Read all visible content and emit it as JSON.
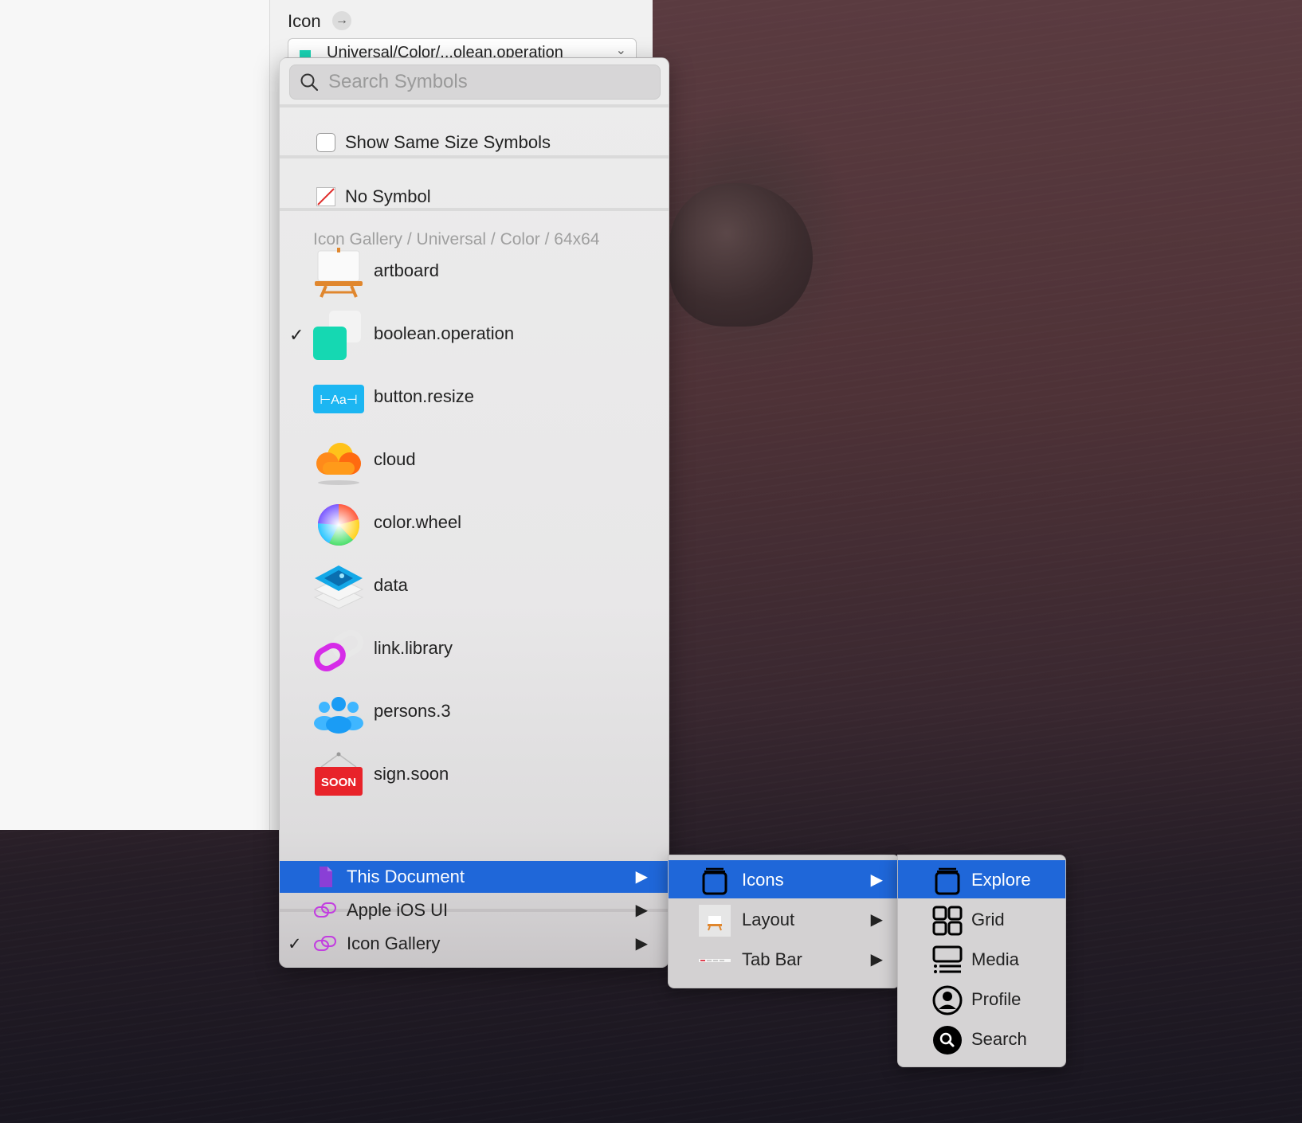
{
  "inspector": {
    "icon_label": "Icon",
    "selected_symbol_text": "Universal/Color/...olean.operation"
  },
  "menu": {
    "search_placeholder": "Search Symbols",
    "show_same_size_label": "Show Same Size Symbols",
    "no_symbol_label": "No Symbol",
    "group_header": "Icon Gallery / Universal / Color / 64x64",
    "symbols": [
      {
        "label": "artboard",
        "icon": "artboard-icon",
        "checked": false
      },
      {
        "label": "boolean.operation",
        "icon": "boolean-operation-icon",
        "checked": true
      },
      {
        "label": "button.resize",
        "icon": "button-resize-icon",
        "checked": false
      },
      {
        "label": "cloud",
        "icon": "cloud-icon",
        "checked": false
      },
      {
        "label": "color.wheel",
        "icon": "color-wheel-icon",
        "checked": false
      },
      {
        "label": "data",
        "icon": "data-icon",
        "checked": false
      },
      {
        "label": "link.library",
        "icon": "link-library-icon",
        "checked": false
      },
      {
        "label": "persons.3",
        "icon": "persons-icon",
        "checked": false
      },
      {
        "label": "sign.soon",
        "icon": "sign-soon-icon",
        "checked": false
      }
    ],
    "button_resize_glyph": "⊢Aa⊣",
    "sign_soon_text": "SOON",
    "libraries": [
      {
        "label": "This Document",
        "checked": false,
        "active": true
      },
      {
        "label": "Apple iOS UI",
        "checked": false,
        "active": false
      },
      {
        "label": "Icon Gallery",
        "checked": true,
        "active": false
      }
    ]
  },
  "submenu_this_document": [
    {
      "label": "Icons",
      "active": true
    },
    {
      "label": "Layout",
      "active": false
    },
    {
      "label": "Tab Bar",
      "active": false
    }
  ],
  "submenu_icons": [
    {
      "label": "Explore",
      "active": true
    },
    {
      "label": "Grid",
      "active": false
    },
    {
      "label": "Media",
      "active": false
    },
    {
      "label": "Profile",
      "active": false
    },
    {
      "label": "Search",
      "active": false
    }
  ],
  "glyphs": {
    "check": "✓",
    "submenu_arrow": "▶",
    "chevron": "⌄",
    "forward": "→"
  },
  "colors": {
    "accent": "#1f67d9",
    "link_purple": "#c23ee0",
    "doc_purple": "#8a3fd6"
  }
}
